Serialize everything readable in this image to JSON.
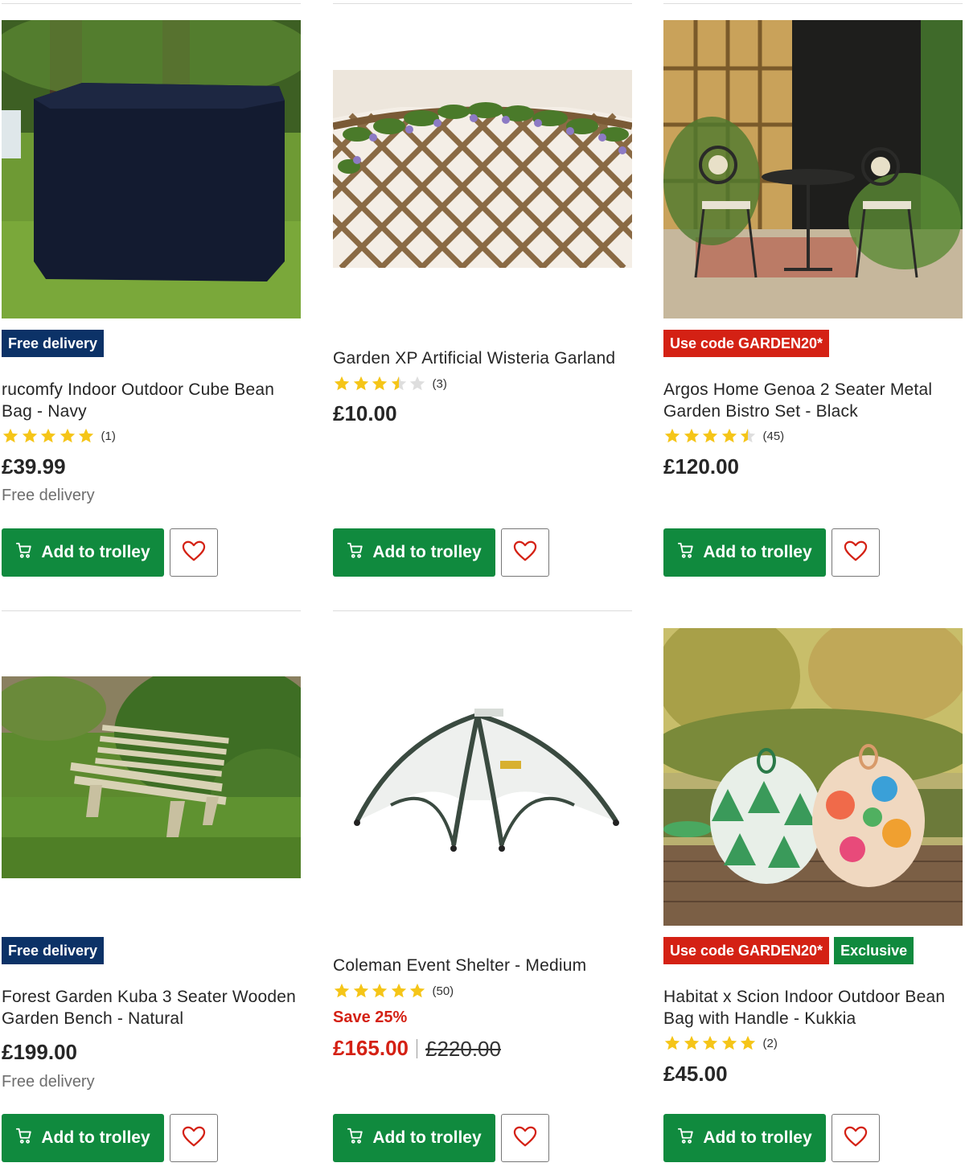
{
  "colors": {
    "accent_green": "#108a3e",
    "badge_blue": "#0c3267",
    "badge_red": "#d42114",
    "star_yellow": "#f5c518",
    "sale_red": "#d42114"
  },
  "icons": {
    "trolley": "trolley-icon",
    "wishlist": "heart-icon",
    "star": "star-icon"
  },
  "products": [
    {
      "badges": [
        "Free delivery"
      ],
      "title_line1": "rucomfy Indoor Outdoor Cube Bean",
      "title_line2": "Bag - Navy",
      "rating": 5,
      "rating_count": "(1)",
      "price": "£39.99",
      "delivery": "Free delivery",
      "add_label": "Add to trolley"
    },
    {
      "badges": [],
      "title_line1": "Garden XP Artificial Wisteria Garland",
      "title_line2": "",
      "rating": 3.5,
      "rating_count": "(3)",
      "price": "£10.00",
      "add_label": "Add to trolley"
    },
    {
      "badges": [
        "Use code GARDEN20*"
      ],
      "title_line1": "Argos Home Genoa 2 Seater Metal",
      "title_line2": "Garden Bistro Set - Black",
      "rating": 4.5,
      "rating_count": "(45)",
      "price": "£120.00",
      "add_label": "Add to trolley"
    },
    {
      "badges": [
        "Free delivery"
      ],
      "title_line1": "Forest Garden Kuba 3 Seater Wooden",
      "title_line2": "Garden Bench - Natural",
      "price": "£199.00",
      "delivery": "Free delivery",
      "add_label": "Add to trolley"
    },
    {
      "badges": [],
      "title_line1": "Coleman Event Shelter - Medium",
      "title_line2": "",
      "rating": 5,
      "rating_count": "(50)",
      "save": "Save 25%",
      "price": "£165.00",
      "was_price": "£220.00",
      "add_label": "Add to trolley"
    },
    {
      "badges": [
        "Use code GARDEN20*",
        "Exclusive"
      ],
      "title_line1": "Habitat x Scion Indoor Outdoor Bean",
      "title_line2": "Bag with Handle - Kukkia",
      "rating": 5,
      "rating_count": "(2)",
      "price": "£45.00",
      "add_label": "Add to trolley"
    }
  ]
}
